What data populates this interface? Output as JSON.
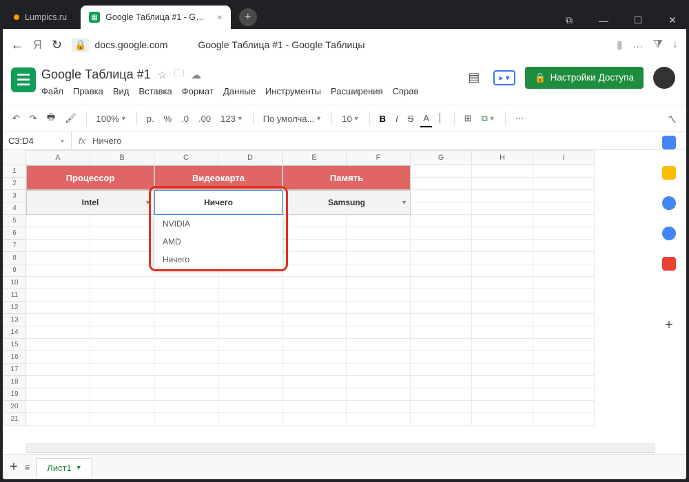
{
  "titlebar": {
    "tab_inactive": "Lumpics.ru",
    "tab_active": "Google Таблица #1 - G…",
    "window_buttons": [
      "library-icon",
      "minimize-icon",
      "maximize-icon",
      "close-icon"
    ]
  },
  "urlbar": {
    "domain": "docs.google.com",
    "page_title": "Google Таблица #1 - Google Таблицы"
  },
  "doc": {
    "name": "Google Таблица #1",
    "menus": [
      "Файл",
      "Правка",
      "Вид",
      "Вставка",
      "Формат",
      "Данные",
      "Инструменты",
      "Расширения",
      "Справ"
    ],
    "share_label": "Настройки Доступа"
  },
  "toolbar": {
    "zoom": "100%",
    "currency": "р.",
    "percent": "%",
    "dec_less": ".0←",
    "dec_more": ".00→",
    "num_format": "123",
    "font": "По умолча...",
    "font_size": "10",
    "more": "⋯"
  },
  "formula": {
    "cell_ref": "C3:D4",
    "fx": "fx",
    "value": "Ничего"
  },
  "grid": {
    "cols": [
      "A",
      "B",
      "C",
      "D",
      "E",
      "F",
      "G",
      "H",
      "I"
    ],
    "rows": 21,
    "headers": [
      {
        "label": "Процессор",
        "col": "AB"
      },
      {
        "label": "Видеокарта",
        "col": "CD"
      },
      {
        "label": "Память",
        "col": "EF"
      }
    ],
    "data_row": [
      {
        "label": "Intel",
        "col": "AB"
      },
      {
        "label": "Ничего",
        "col": "CD"
      },
      {
        "label": "Samsung",
        "col": "EF"
      }
    ],
    "dropdown": {
      "selected": "Ничего",
      "options": [
        "NVIDIA",
        "AMD",
        "Ничего"
      ]
    }
  },
  "sheet_tabs": {
    "tab1": "Лист1"
  }
}
